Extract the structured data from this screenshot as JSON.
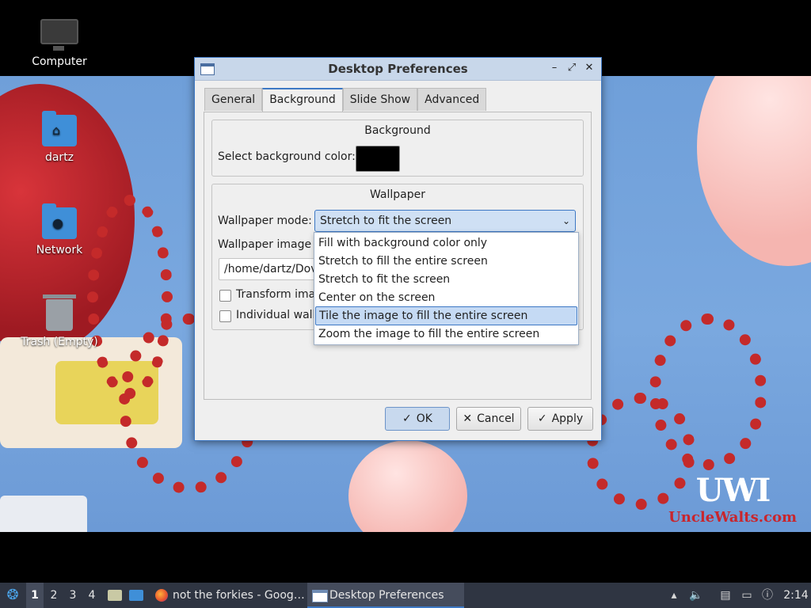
{
  "desktop": {
    "icons": [
      {
        "label": "Computer"
      },
      {
        "label": "dartz"
      },
      {
        "label": "Network"
      },
      {
        "label": "Trash (Empty)"
      }
    ],
    "watermark": {
      "logo": "UWI",
      "site": "UncleWalts.com"
    }
  },
  "dialog": {
    "title": "Desktop Preferences",
    "tabs": [
      {
        "label": "General",
        "active": false
      },
      {
        "label": "Background",
        "active": true
      },
      {
        "label": "Slide Show",
        "active": false
      },
      {
        "label": "Advanced",
        "active": false
      }
    ],
    "background_group": {
      "title": "Background",
      "color_label": "Select background color:",
      "color_value": "#000000"
    },
    "wallpaper_group": {
      "title": "Wallpaper",
      "mode_label": "Wallpaper mode:",
      "mode_value": "Stretch to fit the screen",
      "image_label": "Wallpaper image f",
      "image_path": "/home/dartz/Dov",
      "transform_label": "Transform ima",
      "individual_label": "Individual wall"
    },
    "mode_options": [
      {
        "label": "Fill with background color only",
        "highlighted": false
      },
      {
        "label": "Stretch to fill the entire screen",
        "highlighted": false
      },
      {
        "label": "Stretch to fit the screen",
        "highlighted": false
      },
      {
        "label": "Center on the screen",
        "highlighted": false
      },
      {
        "label": "Tile the image to fill the entire screen",
        "highlighted": true
      },
      {
        "label": "Zoom the image to fill the entire screen",
        "highlighted": false
      }
    ],
    "buttons": {
      "ok": "OK",
      "cancel": "Cancel",
      "apply": "Apply"
    }
  },
  "taskbar": {
    "workspaces": [
      "1",
      "2",
      "3",
      "4"
    ],
    "active_workspace": "1",
    "tasks": [
      {
        "label": "not the forkies - Goog…",
        "icon": "firefox-icon"
      },
      {
        "label": "Desktop Preferences",
        "icon": "window-icon",
        "active": true
      }
    ],
    "clock": "2:14"
  },
  "colors": {
    "accent": "#3d78c4",
    "taskbar": "#2f3542",
    "wallpaper_sky": "#7aa8df"
  }
}
